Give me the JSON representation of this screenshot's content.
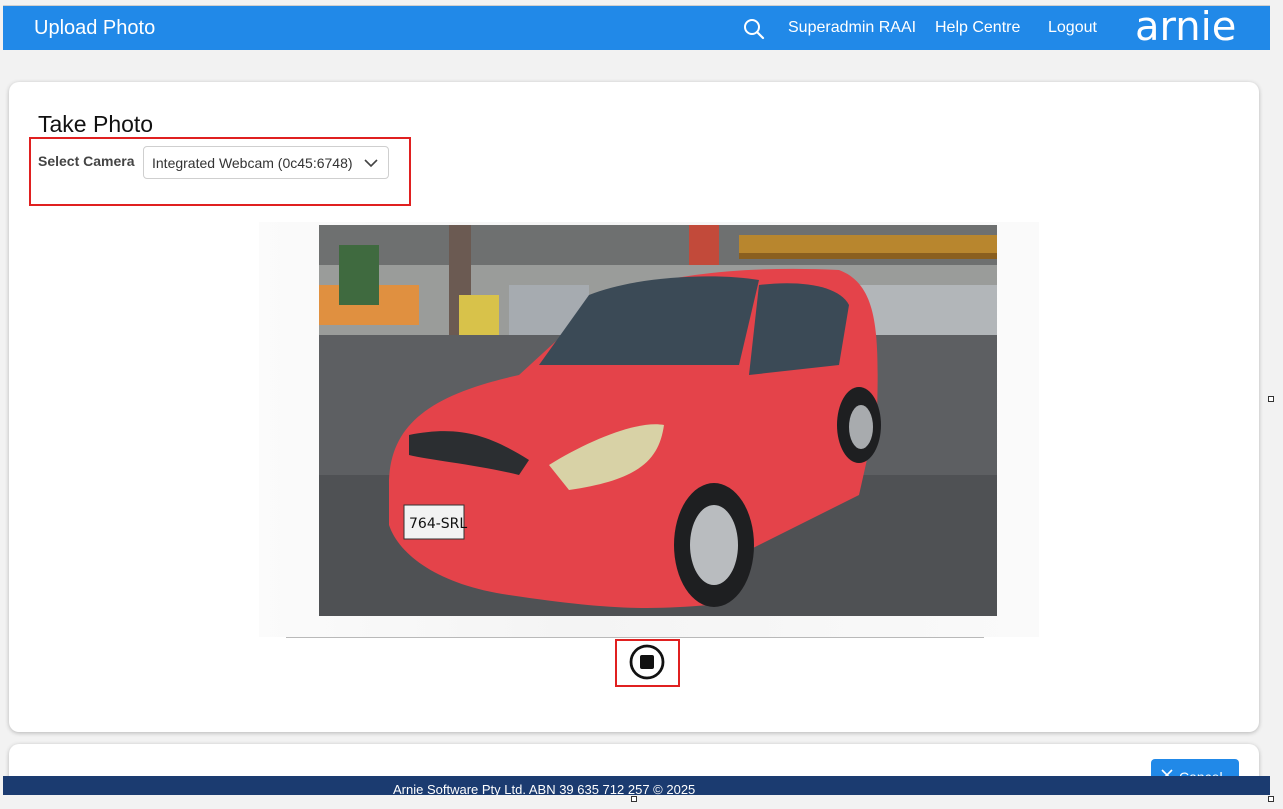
{
  "header": {
    "title": "Upload Photo",
    "nav": [
      "Superadmin RAAI",
      "Help Centre",
      "Logout"
    ],
    "logo_text": "arnie",
    "brand_color": "#2189e8"
  },
  "camera": {
    "section_title": "Take Photo",
    "select_label": "Select Camera",
    "selected_camera": "Integrated Webcam (0c45:6748)"
  },
  "photo": {
    "plate_text": "764-SRL"
  },
  "actions": {
    "stop_icon": "stop-circle-icon",
    "cancel_label": "Cancel"
  },
  "footer": {
    "text": "Arnie Software Pty Ltd. ABN 39 635 712 257 © 2025",
    "color": "#1b3b70"
  },
  "highlight_color": "#e02020"
}
